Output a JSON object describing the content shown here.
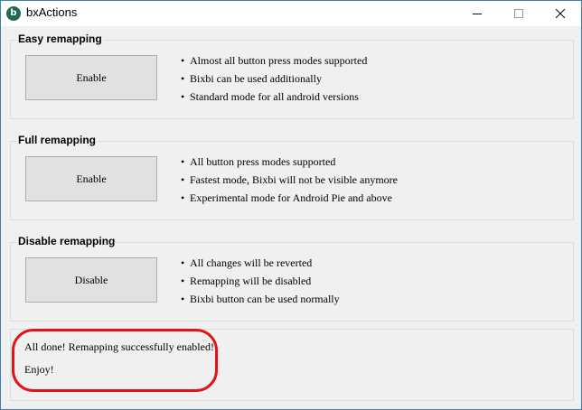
{
  "window": {
    "title": "bxActions",
    "app_icon_glyph": "b",
    "accent_color": "#1f6b52"
  },
  "groups": [
    {
      "title": "Easy remapping",
      "button_label": "Enable",
      "bullets": [
        "Almost all button press modes supported",
        "Bixbi can be used additionally",
        "Standard mode for all android versions"
      ]
    },
    {
      "title": "Full remapping",
      "button_label": "Enable",
      "bullets": [
        "All button press modes supported",
        "Fastest mode, Bixbi will not be visible anymore",
        "Experimental mode for Android Pie and above"
      ]
    },
    {
      "title": "Disable remapping",
      "button_label": "Disable",
      "bullets": [
        "All changes will be reverted",
        "Remapping will be disabled",
        "Bixbi button can be used normally"
      ]
    }
  ],
  "status": {
    "lines": [
      "All done! Remapping successfully enabled!",
      "Enjoy!"
    ],
    "highlight_color": "#e0141a"
  },
  "bullet_glyph": "•"
}
